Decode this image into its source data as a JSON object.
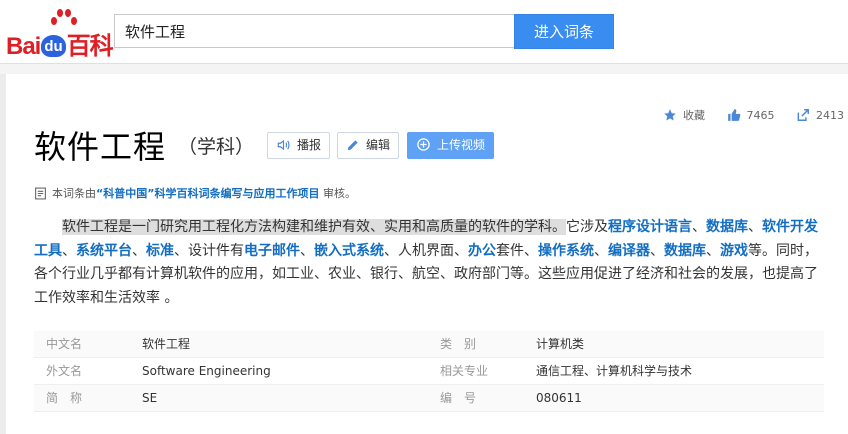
{
  "header": {
    "logo_text_1": "Bai",
    "logo_text_2": "du",
    "logo_text_3": "百科",
    "search_value": "软件工程",
    "search_button": "进入词条"
  },
  "stats": {
    "favorite_label": "收藏",
    "like_count": "7465",
    "share_count": "2413"
  },
  "entry": {
    "title": "软件工程",
    "subtitle": "（学科）",
    "buttons": {
      "play": "播报",
      "edit": "编辑",
      "upload": "上传视频"
    }
  },
  "review": {
    "prefix": "本词条由",
    "source": "“科普中国”科学百科词条编写与应用工作项目",
    "suffix": " 审核。"
  },
  "summary": {
    "highlight": "软件工程是一门研究用工程化方法构建和维护有效、实用和高质量的软件的学科。",
    "t1": "它涉及",
    "l1": "程序设计语言",
    "t2": "、",
    "l2": "数据库",
    "t3": "、",
    "l3": "软件开发工具",
    "t4": "、",
    "l4": "系统平台",
    "t5": "、",
    "l5": "标准",
    "t6": "、设计件有",
    "l6": "电子邮件",
    "t7": "、",
    "l7": "嵌入式系统",
    "t8": "、人机界面、",
    "l8": "办公",
    "t9": "套件、",
    "l9": "操作系统",
    "t10": "、",
    "l10": "编译器",
    "t11": "、",
    "l11": "数据库",
    "t12": "、",
    "l12": "游戏",
    "t13": "等。同时，各个行业几乎都有计算机软件的应用，如工业、农业、银行、航空、政府部门等。这些应用促进了经济和社会的发展，也提高了工作效率和生活效率 。"
  },
  "basic_info": [
    {
      "k1": "中文名",
      "v1": "软件工程",
      "k2": "类　别",
      "v2": "计算机类"
    },
    {
      "k1": "外文名",
      "v1": "Software Engineering",
      "k2": "相关专业",
      "v2": "通信工程、计算机科学与技术"
    },
    {
      "k1": "简　称",
      "v1": "SE",
      "k2": "编　号",
      "v2": "080611"
    }
  ]
}
